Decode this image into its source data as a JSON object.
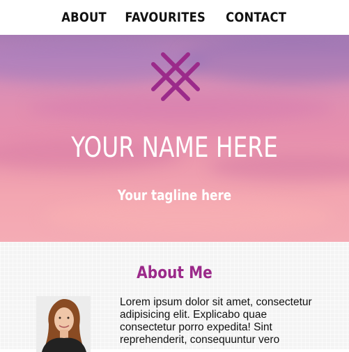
{
  "nav": {
    "items": [
      {
        "label": "ABOUT"
      },
      {
        "label": "FAVOURITES"
      },
      {
        "label": "CONTACT"
      }
    ]
  },
  "hero": {
    "logo_icon": "crosshatch-logo-icon",
    "name": "YOUR NAME HERE",
    "tagline": "Your tagline here"
  },
  "about": {
    "title": "About Me",
    "portrait_icon": "portrait-photo",
    "text": "Lorem ipsum dolor sit amet, consectetur adipisicing elit. Explicabo quae consectetur porro expedita! Sint reprehenderit, consequuntur vero"
  },
  "colors": {
    "accent": "#9b2a8a",
    "nav_text": "#111111",
    "hero_text": "#ffffff"
  }
}
